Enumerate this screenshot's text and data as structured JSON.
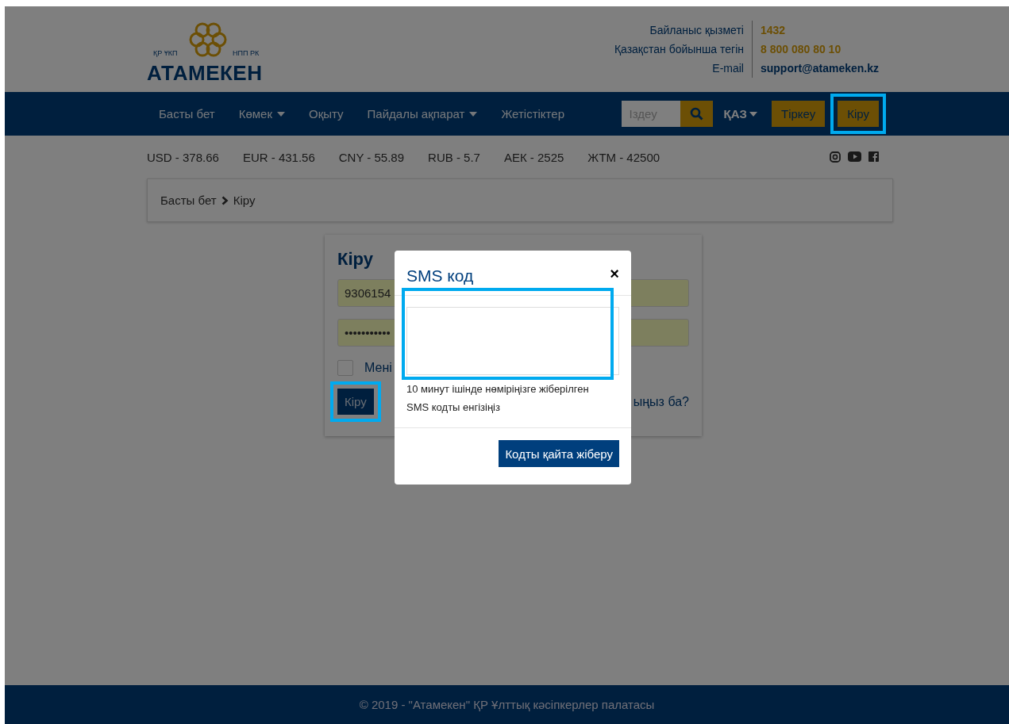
{
  "header": {
    "logo": {
      "left_caption": "ҚР ҰКП",
      "right_caption": "НПП РК",
      "name": "АТАМЕКЕН"
    },
    "contacts": [
      {
        "label": "Байланыс қызметі",
        "value": "1432",
        "kind": "phone"
      },
      {
        "label": "Қазақстан бойынша тегін",
        "value": "8 800 080 80 10",
        "kind": "phone"
      },
      {
        "label": "E-mail",
        "value": "support@atameken.kz",
        "kind": "email"
      }
    ]
  },
  "nav": {
    "items": [
      {
        "label": "Басты бет",
        "dropdown": false
      },
      {
        "label": "Көмек",
        "dropdown": true
      },
      {
        "label": "Оқыту",
        "dropdown": false
      },
      {
        "label": "Пайдалы ақпарат",
        "dropdown": true
      },
      {
        "label": "Жетістіктер",
        "dropdown": false
      }
    ],
    "search": {
      "placeholder": "Іздеу"
    },
    "language": "ҚАЗ",
    "buttons": [
      {
        "label": "Тіркеу",
        "highlighted": false
      },
      {
        "label": "Кіру",
        "highlighted": true
      }
    ]
  },
  "rates": [
    "USD - 378.66",
    "EUR - 431.56",
    "CNY - 55.89",
    "RUB - 5.7",
    "АЕК - 2525",
    "ЖТМ - 42500"
  ],
  "breadcrumb": [
    "Басты бет",
    "Кіру"
  ],
  "login": {
    "title": "Кіру",
    "login_value": "9306154",
    "password_value": "•••••••••••",
    "remember": {
      "label": "Мені",
      "checked": false
    },
    "submit": {
      "label": "Кіру",
      "highlighted": true
    },
    "link": "ыңыз ба?"
  },
  "modal": {
    "title": "SMS код",
    "close": "×",
    "code_field": {
      "highlighted": true
    },
    "hint": "10 минут ішінде нөміріңізге жіберілген SMS кодты енгізіңіз",
    "button": "Кодты қайта жіберу"
  },
  "footer": "© 2019 - \"Атамекен\" ҚР Ұлттық кәсіпкерлер палатасы"
}
